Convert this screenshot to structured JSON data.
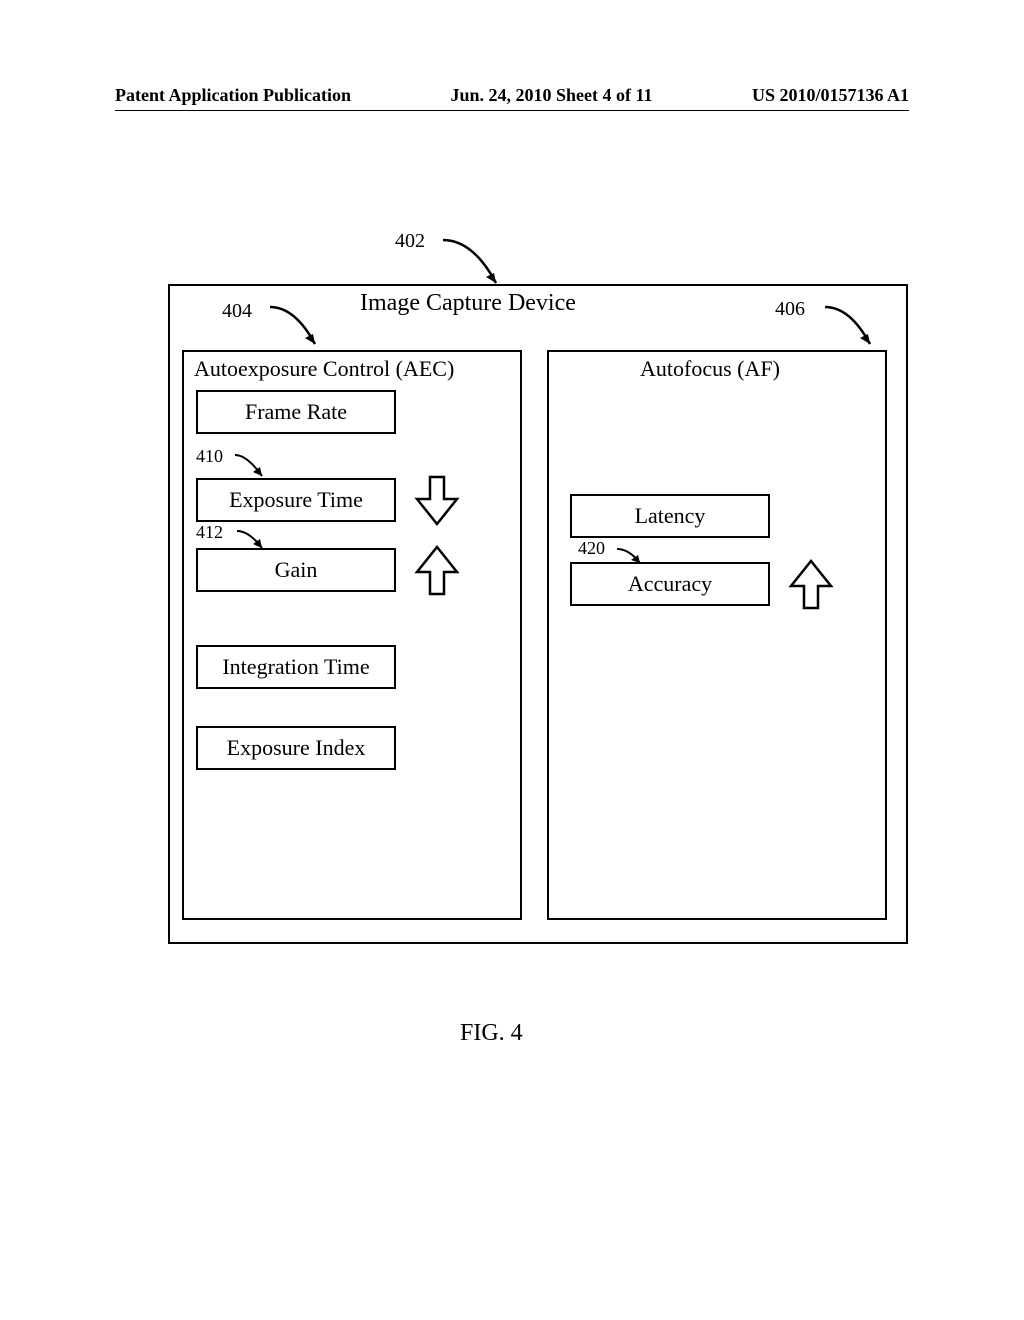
{
  "header": {
    "left": "Patent Application Publication",
    "center": "Jun. 24, 2010  Sheet 4 of 11",
    "right": "US 2010/0157136 A1"
  },
  "labels": {
    "l402": "402",
    "l404": "404",
    "l406": "406",
    "l410": "410",
    "l412": "412",
    "l420": "420"
  },
  "device": {
    "title": "Image Capture Device"
  },
  "aec": {
    "title": "Autoexposure Control (AEC)",
    "frame_rate": "Frame Rate",
    "exposure_time": "Exposure Time",
    "gain": "Gain",
    "integration_time": "Integration Time",
    "exposure_index": "Exposure Index"
  },
  "af": {
    "title": "Autofocus (AF)",
    "latency": "Latency",
    "accuracy": "Accuracy"
  },
  "caption": "FIG. 4"
}
